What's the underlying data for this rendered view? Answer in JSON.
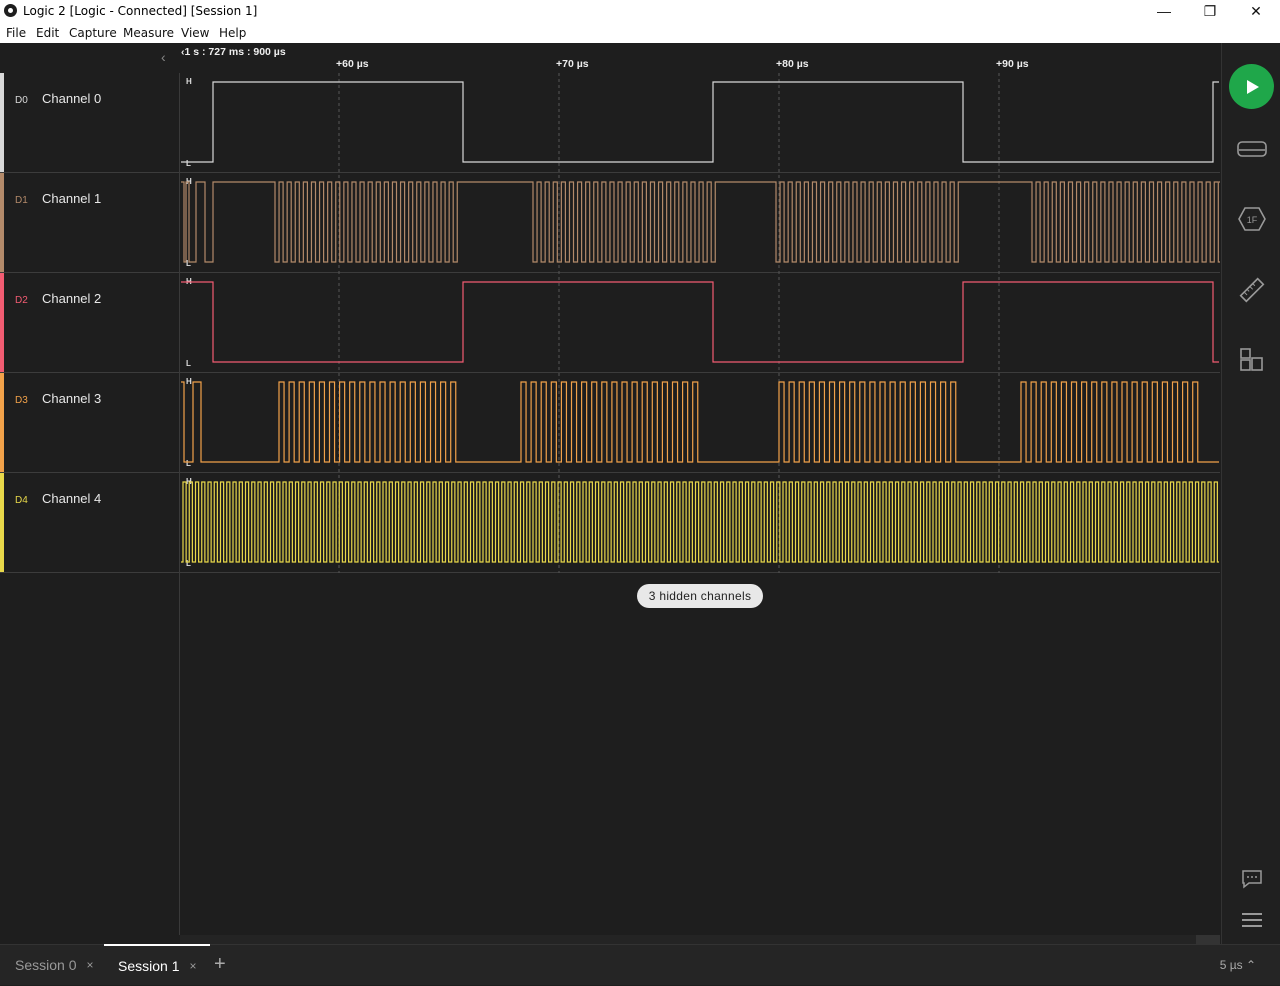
{
  "window": {
    "title": "Logic 2 [Logic - Connected] [Session 1]",
    "minimize_glyph": "—",
    "maximize_glyph": "❐",
    "close_glyph": "✕"
  },
  "menu": [
    "File",
    "Edit",
    "Capture",
    "Measure",
    "View",
    "Help"
  ],
  "timebar": {
    "origin": "‹1 s : 727 ms : 900 µs",
    "ticks": [
      "+60 µs",
      "+70 µs",
      "+80 µs",
      "+90 µs"
    ],
    "collapse_glyph": "‹"
  },
  "channels": [
    {
      "id": "D0",
      "name": "Channel 0",
      "color": "#d9d9d9",
      "high": "H",
      "low": "L"
    },
    {
      "id": "D1",
      "name": "Channel 1",
      "color": "#b38a6a",
      "high": "H",
      "low": "L"
    },
    {
      "id": "D2",
      "name": "Channel 2",
      "color": "#f25c72",
      "high": "H",
      "low": "L"
    },
    {
      "id": "D3",
      "name": "Channel 3",
      "color": "#f2a24a",
      "high": "H",
      "low": "L"
    },
    {
      "id": "D4",
      "name": "Channel 4",
      "color": "#e8d84a",
      "high": "H",
      "low": "L"
    }
  ],
  "hidden_channels_label": "3 hidden channels",
  "right_toolbar": [
    "play-icon",
    "device-icon",
    "analyzer-icon",
    "measure-icon",
    "extensions-icon",
    "comment-icon",
    "menu-icon"
  ],
  "tabs": [
    {
      "label": "Session 0",
      "close": "×",
      "active": false
    },
    {
      "label": "Session 1",
      "close": "×",
      "active": true
    }
  ],
  "add_tab": "+",
  "zoom": "5 µs ⌃"
}
